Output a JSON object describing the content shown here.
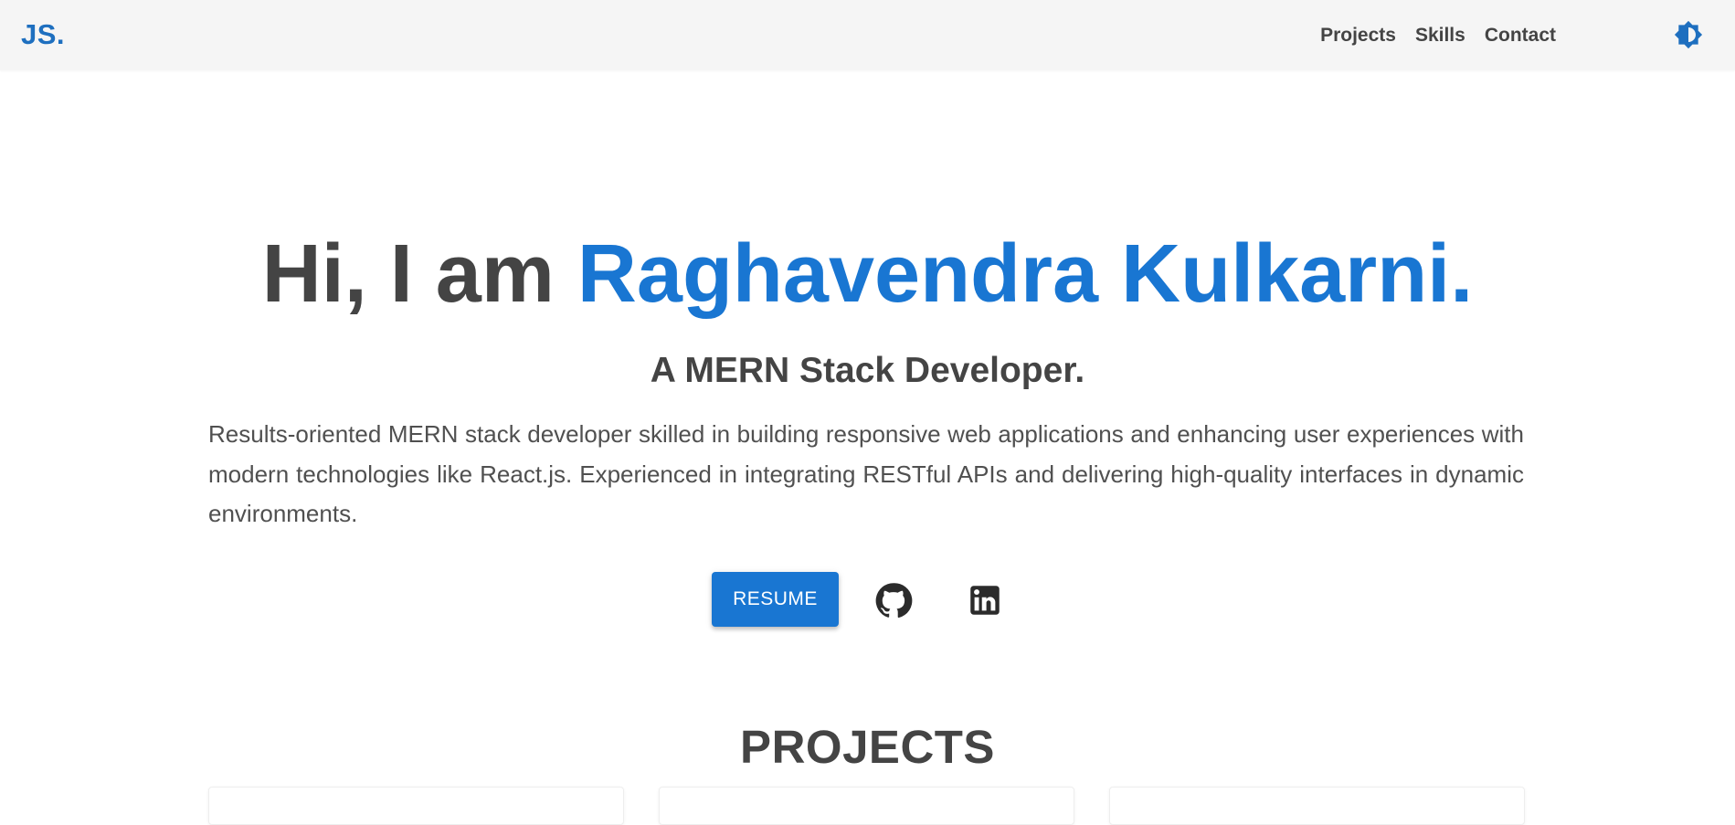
{
  "header": {
    "logo": "JS.",
    "nav": [
      "Projects",
      "Skills",
      "Contact"
    ],
    "theme_toggle_icon": "brightness-icon"
  },
  "hero": {
    "greeting": "Hi, I am",
    "name": "Raghavendra Kulkarni.",
    "subtitle": "A MERN Stack Developer.",
    "description": "Results-oriented MERN stack developer skilled in building responsive web applications and enhancing user experiences with modern technologies like React.js. Experienced in integrating RESTful APIs and delivering high-quality interfaces in dynamic environments.",
    "resume_label": "RESUME",
    "social": [
      "github-icon",
      "linkedin-icon"
    ]
  },
  "projects": {
    "heading": "PROJECTS"
  },
  "colors": {
    "accent": "#1976d2",
    "logo": "#1e6fbf",
    "text": "#444444",
    "navbar_bg": "#f5f5f5"
  }
}
